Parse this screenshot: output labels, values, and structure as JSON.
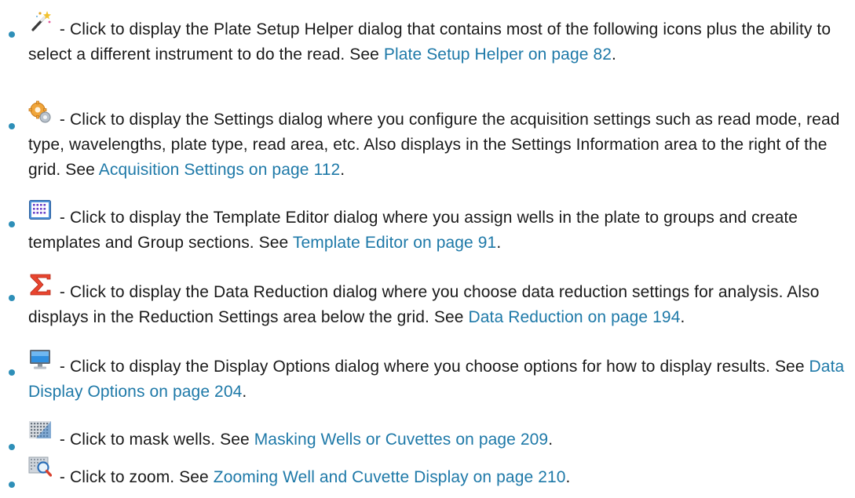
{
  "items": [
    {
      "icon": "magic-wand-icon",
      "text": " - Click to display the Plate Setup Helper dialog that contains most of the following icons plus the ability to select a different instrument to do the read. See ",
      "link": "Plate Setup Helper on page 82",
      "tail": "."
    },
    {
      "icon": "settings-gears-icon",
      "text": " - Click to display the Settings dialog where you configure the acquisition settings such as read mode, read type, wavelengths, plate type, read area, etc. Also displays in the Settings Information area to the right of the grid. See ",
      "link": "Acquisition Settings on page 112",
      "tail": "."
    },
    {
      "icon": "template-grid-icon",
      "text": " - Click to display the Template Editor dialog where you assign wells in the plate to groups and create templates and Group sections. See ",
      "link": "Template Editor on page 91",
      "tail": "."
    },
    {
      "icon": "sigma-icon",
      "text": " - Click to display the Data Reduction dialog where you choose data reduction settings for analysis. Also displays in the Reduction Settings area below the grid. See ",
      "link": "Data Reduction on page 194",
      "tail": "."
    },
    {
      "icon": "monitor-icon",
      "text": " - Click to display the Display Options dialog where you choose options for how to display results. See ",
      "link": "Data Display Options on page 204",
      "tail": "."
    },
    {
      "icon": "mask-wells-icon",
      "text": " - Click to mask wells. See ",
      "link": "Masking Wells or Cuvettes on page 209",
      "tail": "."
    },
    {
      "icon": "zoom-icon",
      "text": " - Click to zoom. See ",
      "link": "Zooming Well and Cuvette Display on page 210",
      "tail": "."
    }
  ],
  "colors": {
    "bullet": "#2e8fb8",
    "link": "#1e79a8",
    "text": "#1a1a1a"
  }
}
